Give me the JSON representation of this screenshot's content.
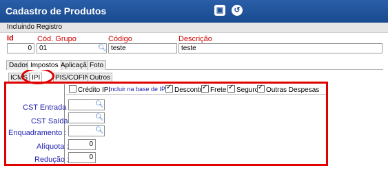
{
  "window": {
    "title": "Cadastro de Produtos",
    "status": "Incluindo Registro",
    "buttons": [
      {
        "name": "save",
        "icon": "floppy-disk-icon"
      },
      {
        "name": "undo",
        "icon": "undo-icon"
      }
    ]
  },
  "header": {
    "id_label": "Id",
    "id_value": "0",
    "group_label": "Cód. Grupo",
    "group_value": "01",
    "code_label": "Código",
    "code_value": "teste",
    "desc_label": "Descrição",
    "desc_value": "teste"
  },
  "tabs": [
    "Dados",
    "Impostos",
    "Aplicação",
    "Foto"
  ],
  "active_tab": "Impostos",
  "subtabs": [
    "ICMS",
    "IPI",
    "PIS/COFINS",
    "Outros"
  ],
  "active_subtab": "IPI",
  "ipi": {
    "credit_label": "Crédito IPI",
    "credit_checked": false,
    "include_label": "Incluir na base de IPI :",
    "options": [
      {
        "label": "Desconto",
        "checked": true
      },
      {
        "label": "Frete",
        "checked": true
      },
      {
        "label": "Seguro",
        "checked": true
      },
      {
        "label": "Outras Despesas",
        "checked": true
      }
    ],
    "cst_entrada_label": "CST Entrada :",
    "cst_entrada_value": "",
    "cst_saida_label": "CST Saída :",
    "cst_saida_value": "",
    "enquadramento_label": "Enquadramento :",
    "enquadramento_value": "",
    "aliquota_label": "Alíquota :",
    "aliquota_value": "0",
    "reducao_label": "Redução :",
    "reducao_value": "0"
  },
  "colors": {
    "titlebar": "#1f55a0",
    "highlight": "#e00000",
    "label_blue": "#2222b0",
    "label_red": "#d00000"
  }
}
